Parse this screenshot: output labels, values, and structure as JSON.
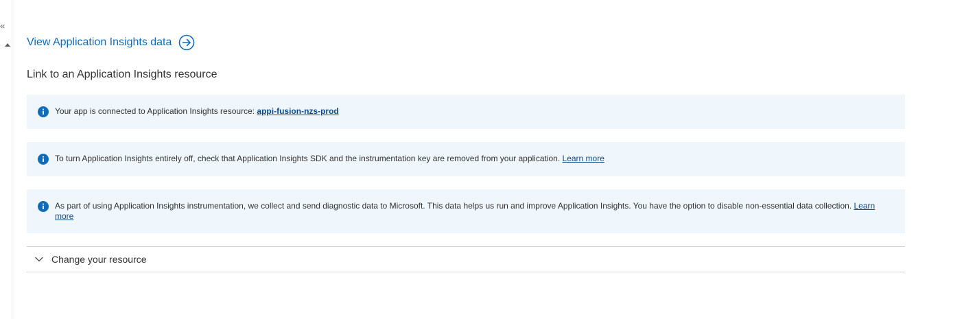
{
  "rail": {
    "collapse_glyph": "«",
    "icons": {
      "collapse": "double-chevron-left-icon",
      "scroll": "scroll-up-arrow-icon"
    }
  },
  "view_link": {
    "label": "View Application Insights data",
    "icon": "circle-arrow-right-icon"
  },
  "section": {
    "title": "Link to an Application Insights resource"
  },
  "banners": [
    {
      "icon": "info-icon",
      "text": "Your app is connected to Application Insights resource:",
      "link": "appi-fusion-nzs-prod"
    },
    {
      "icon": "info-icon",
      "text": "To turn Application Insights entirely off, check that Application Insights SDK and the instrumentation key are removed from your application.",
      "link": "Learn more"
    },
    {
      "icon": "info-icon",
      "text": "As part of using Application Insights instrumentation, we collect and send diagnostic data to Microsoft. This data helps us run and improve Application Insights. You have the option to disable non-essential data collection.",
      "link": "Learn more"
    }
  ],
  "accordion": {
    "label": "Change your resource",
    "icon": "chevron-down-icon",
    "expanded": false
  },
  "colors": {
    "link": "#0f6cbd",
    "banner_bg": "#eff6fc",
    "info_icon": "#0f6cbd",
    "text": "#323130",
    "divider": "#d2d0ce"
  }
}
